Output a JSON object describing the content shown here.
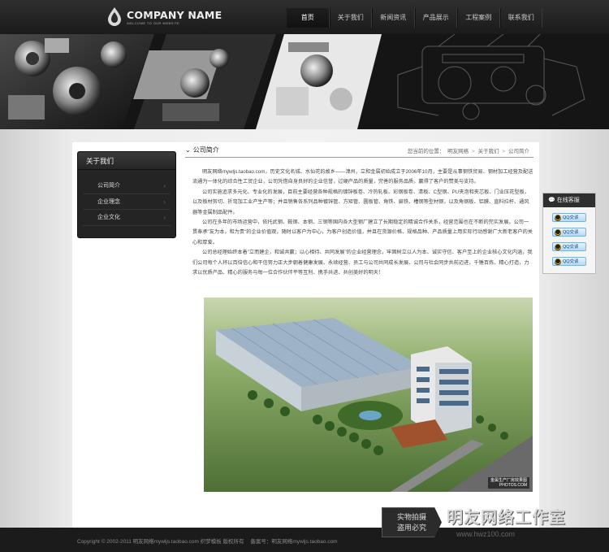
{
  "header": {
    "logo_name": "COMPANY NAME",
    "logo_sub": "WELCOME TO OUR WEBSITE",
    "nav": [
      {
        "label": "首页",
        "active": true
      },
      {
        "label": "关于我们",
        "active": false
      },
      {
        "label": "新闻资讯",
        "active": false
      },
      {
        "label": "产品展示",
        "active": false
      },
      {
        "label": "工程案例",
        "active": false
      },
      {
        "label": "联系我们",
        "active": false
      }
    ]
  },
  "sidebar": {
    "title": "关于我们",
    "items": [
      {
        "label": "公司简介",
        "arrow": "›"
      },
      {
        "label": "企业理念",
        "arrow": "›"
      },
      {
        "label": "企业文化",
        "arrow": "›"
      }
    ]
  },
  "main": {
    "chevron": "⌄",
    "title": "公司简介",
    "breadcrumb": {
      "prefix": "您当前的位置：",
      "items": [
        "明友网络",
        "关于我们",
        "公司简介"
      ],
      "sep": ">"
    },
    "paragraphs": [
      "明友网络mywljs.taobao.com，历史文化名城、水仙花的故乡——漳州，立和金属初始成立于2006年10月，主要是从事钢铁贸易、钢材加工经营及配送流通为一体化的综合性工贸企业，公司凭借自身良好的企业信誉，过硬产品的质量，完善的服务品质，赢得了客户的赞美与支持。",
      "公司实施追求多元化、专业化的发展，目前主要经营各种规格的镀锌板卷、冷热轧板、彩钢板卷、清板、C型钢、PU夹泡和夹芯板、门业压花型板，以及板材剪切、折弯加工业产生产等；并且销售各系列品种镀锌管、方矩管、圆板管、角铁、扁铁、槽钢等型材钢，以及角钢板、铝膜、直料拉杆、通风器等金属制品配件。",
      "公司在多年的市场运营中，依托武钢、鞍钢、本钢、三钢等国内各大型钢厂建立了长期稳定的精诚合作关系，经营范围也在不断的完实发展，公司一贯奉承\"友为本，和为贵\"的企业价值观，随时以客户为中心，为客户创造价值，并且在货源价格、规格品种、产品质量上用实际行动感谢广大新老客户的关心和厚爱。",
      "公司总经理始终本着\"立而建企，和诚共赢；以心相待、共同发展\"的企业经营理念，牢固树立以人为本、诚实守信、客户至上的企业核心文化内涵，我们公司每个人将以百倍信心和干信努力正大步朝着健康发展、永续经营、员工与公司共同成长发展、公司与社会同步共前迈进，千锤百炼、精心打造，力求以优质产品、精心的服务与每一位合作伙伴平等互利、携手共进、共创美好的明天！"
    ],
    "photo_caption_line1": "金属生产厂房效果图",
    "photo_caption_line2": "PHOTOS.COM"
  },
  "service": {
    "title": "在线客服",
    "icon": "chat-bubble-icon",
    "buttons": [
      "QQ交谈",
      "QQ交谈",
      "QQ交谈",
      "QQ交谈"
    ]
  },
  "footer": {
    "copyright": "Copyright © 2002-2011 明友网络mywljs.taobao.com 织梦模板 版权所有",
    "icp": "备案号：明友网络mywljs.taobao.com"
  },
  "watermark": {
    "line1": "实物拍摄",
    "line2": "盗用必究",
    "brand": "明友网络工作室",
    "url": "www.hwz100.com"
  },
  "colors": {
    "topbar": "#222222",
    "banner": "#181818",
    "sidebar": "#242424",
    "footer": "#1b1b1b",
    "qq_button": "#b7d9f7"
  }
}
